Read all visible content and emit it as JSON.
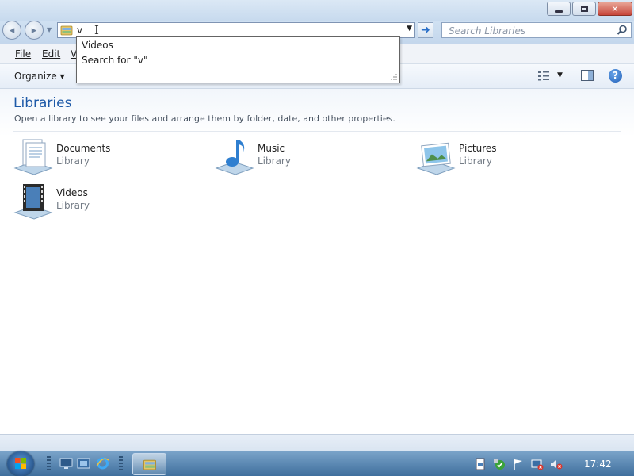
{
  "window": {
    "controls": {
      "minimize_icon": "minimize-icon",
      "maximize_icon": "restore-icon",
      "close_icon": "close-icon"
    }
  },
  "nav": {
    "address_value": "v",
    "search_placeholder": "Search Libraries"
  },
  "autocomplete": {
    "items": [
      "Videos",
      "Search for \"v\""
    ]
  },
  "menubar": {
    "items": [
      {
        "label": "File"
      },
      {
        "label": "Edit"
      },
      {
        "label": "V"
      }
    ]
  },
  "command_bar": {
    "organize_label": "Organize ▾"
  },
  "main": {
    "title": "Libraries",
    "description": "Open a library to see your files and arrange them by folder, date, and other properties.",
    "libraries": [
      {
        "name": "Documents",
        "kind": "Library",
        "icon": "documents-library-icon"
      },
      {
        "name": "Music",
        "kind": "Library",
        "icon": "music-library-icon"
      },
      {
        "name": "Pictures",
        "kind": "Library",
        "icon": "pictures-library-icon"
      },
      {
        "name": "Videos",
        "kind": "Library",
        "icon": "videos-library-icon"
      }
    ]
  },
  "taskbar": {
    "clock": "17:42"
  },
  "colors": {
    "title_blue": "#1e5aa8",
    "taskbar": "#3f6f9d",
    "close_red": "#c7453a"
  }
}
